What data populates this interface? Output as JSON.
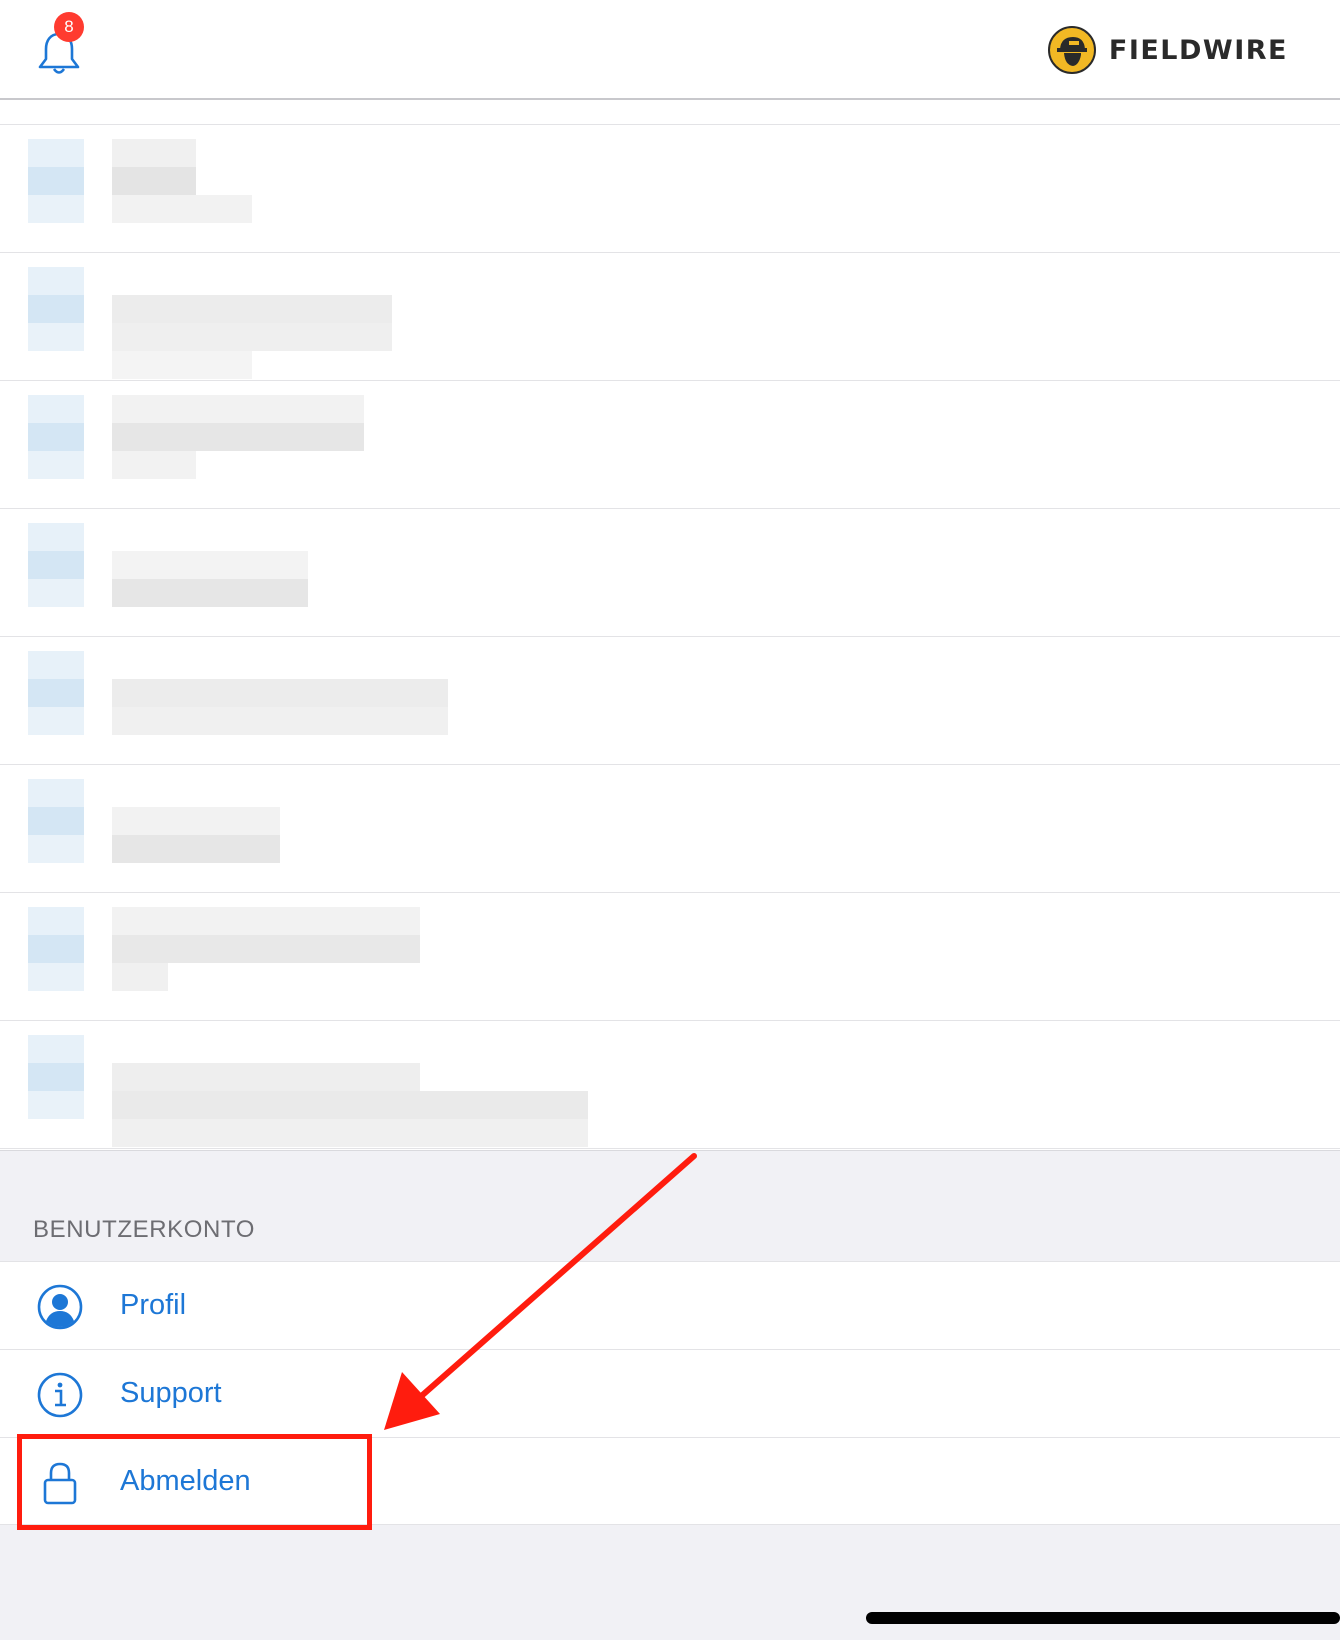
{
  "header": {
    "notifications": {
      "icon": "bell-icon",
      "badge_count": "8"
    },
    "brand": {
      "logo_icon": "fieldwire-logo",
      "name": "FIELDWIRE"
    }
  },
  "projects": {
    "row_count": 8,
    "note": ""
  },
  "account_section": {
    "title": "BENUTZERKONTO",
    "items": [
      {
        "label": "Profil",
        "icon": "user-circle-icon"
      },
      {
        "label": "Support",
        "icon": "info-circle-icon"
      },
      {
        "label": "Abmelden",
        "icon": "lock-icon"
      }
    ]
  },
  "colors": {
    "accent": "#1d77d6",
    "badge": "#ff3b30",
    "annotation": "#ff1c0e",
    "brand_yellow": "#f2b824"
  }
}
